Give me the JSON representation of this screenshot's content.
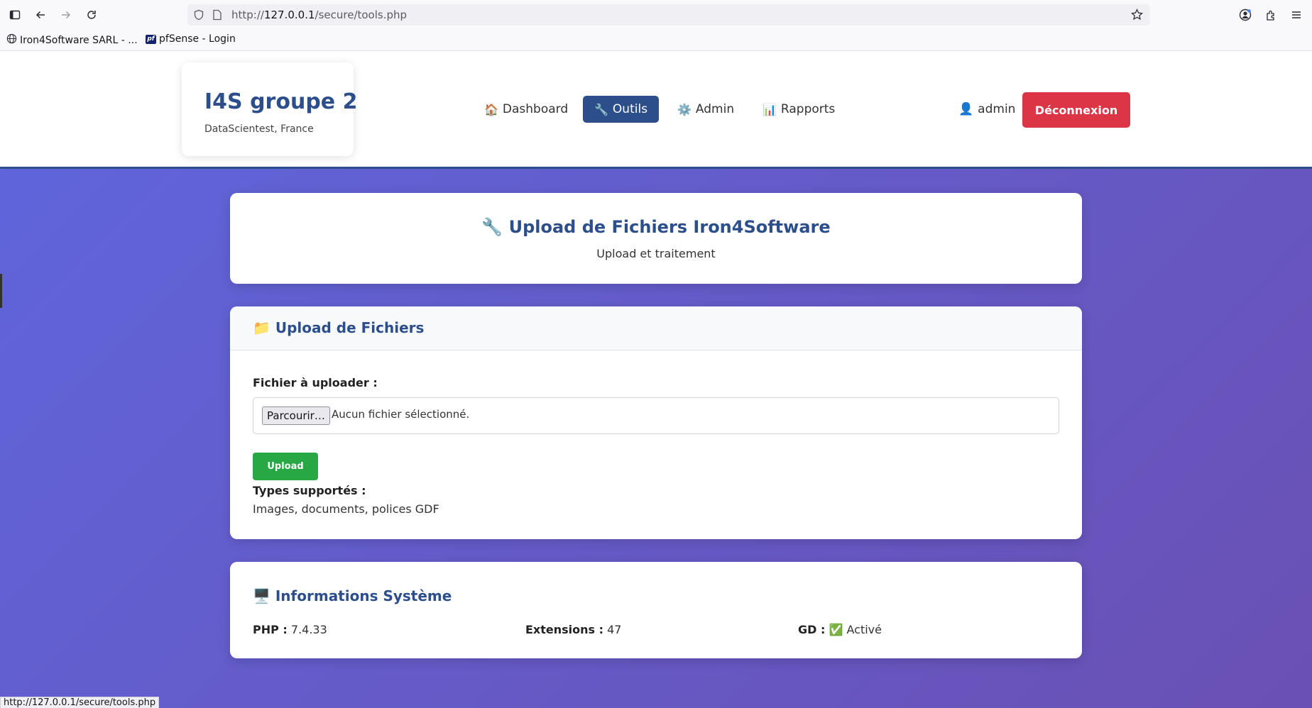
{
  "browser": {
    "url_prefix": "http://",
    "url_host": "127.0.0.1",
    "url_path": "/secure/tools.php",
    "bookmarks": [
      {
        "label": "Iron4Software SARL - ..."
      },
      {
        "label": "pfSense - Login"
      }
    ],
    "status_url": "http://127.0.0.1/secure/tools.php"
  },
  "brand": {
    "title": "I4S groupe 2",
    "subtitle": "DataScientest, France"
  },
  "nav": [
    {
      "icon": "🏠",
      "label": "Dashboard"
    },
    {
      "icon": "🔧",
      "label": "Outils"
    },
    {
      "icon": "⚙️",
      "label": "Admin"
    },
    {
      "icon": "📊",
      "label": "Rapports"
    }
  ],
  "user": {
    "icon": "👤",
    "name": "admin",
    "logout_label": "Déconnexion"
  },
  "hero": {
    "title": "🔧 Upload de Fichiers Iron4Software",
    "subtitle": "Upload et traitement"
  },
  "upload": {
    "title": "📁 Upload de Fichiers",
    "field_label": "Fichier à uploader :",
    "browse_label": "Parcourir…",
    "no_file_text": "Aucun fichier sélectionné.",
    "button_label": "Upload",
    "types_label": "Types supportés :",
    "types_value": "Images, documents, polices GDF"
  },
  "system": {
    "title": "🖥️ Informations Système",
    "php_label": "PHP :",
    "php_value": " 7.4.33",
    "ext_label": "Extensions :",
    "ext_value": " 47",
    "gd_label": "GD :",
    "gd_value": " ✅ Activé"
  },
  "colors": {
    "accent": "#2c4f8c",
    "danger": "#dc3545",
    "success": "#28a745"
  }
}
